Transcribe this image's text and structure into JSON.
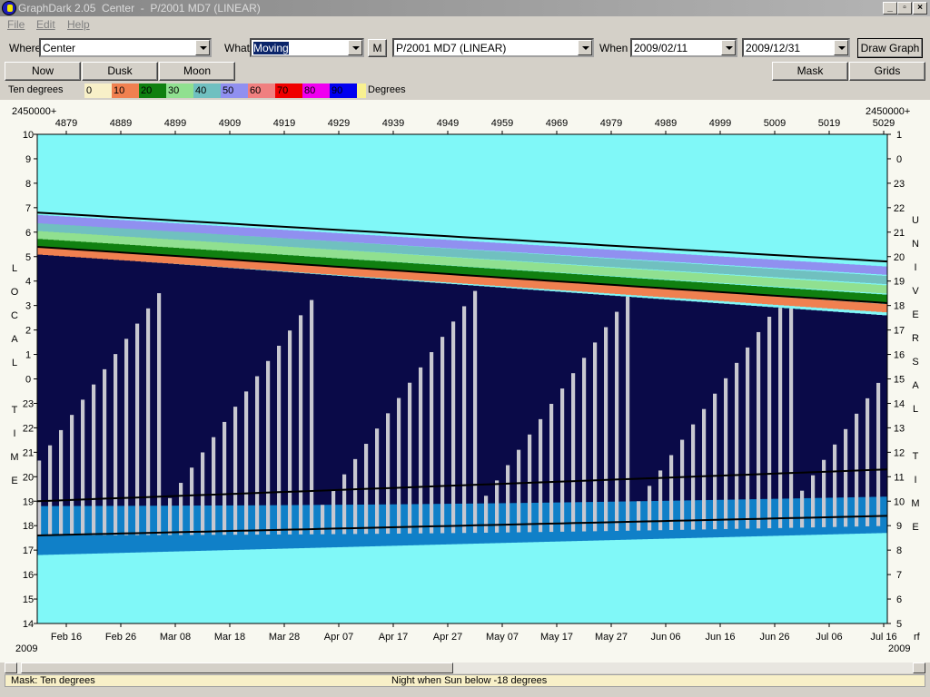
{
  "window": {
    "title": "GraphDark 2.05  Center  -  P/2001 MD7 (LINEAR)"
  },
  "menu": {
    "items": [
      "File",
      "Edit",
      "Help"
    ]
  },
  "toolbar": {
    "where_label": "Where",
    "where_value": "Center",
    "what_label": "What",
    "what_value": "Moving",
    "m_button": "M",
    "object_value": "P/2001 MD7 (LINEAR)",
    "when_label": "When",
    "start_date": "2009/02/11",
    "end_date": "2009/12/31",
    "draw_button": "Draw Graph"
  },
  "buttons": {
    "now": "Now",
    "dusk": "Dusk",
    "moon": "Moon",
    "mask": "Mask",
    "grids": "Grids"
  },
  "legend": {
    "label": "Ten degrees",
    "unit": "Degrees",
    "swatches": [
      {
        "text": "0",
        "color": "#f8f0c8"
      },
      {
        "text": "10",
        "color": "#f08050"
      },
      {
        "text": "20",
        "color": "#108010"
      },
      {
        "text": "30",
        "color": "#90e090"
      },
      {
        "text": "40",
        "color": "#70c0c0"
      },
      {
        "text": "50",
        "color": "#9090f0"
      },
      {
        "text": "60",
        "color": "#f08080"
      },
      {
        "text": "70",
        "color": "#f00000"
      },
      {
        "text": "80",
        "color": "#f000f0"
      },
      {
        "text": "90",
        "color": "#0000f0"
      },
      {
        "text": "",
        "color": "#f8f090"
      }
    ]
  },
  "chart": {
    "jd_prefix_left": "2450000+",
    "jd_prefix_right": "2450000+",
    "jd_ticks": [
      "4879",
      "4889",
      "4899",
      "4909",
      "4919",
      "4929",
      "4939",
      "4949",
      "4959",
      "4969",
      "4979",
      "4989",
      "4999",
      "5009",
      "5019",
      "5029"
    ],
    "left_ticks": [
      "10",
      "9",
      "8",
      "7",
      "6",
      "5",
      "4",
      "3",
      "2",
      "1",
      "0",
      "23",
      "22",
      "21",
      "20",
      "19",
      "18",
      "17",
      "16",
      "15",
      "14"
    ],
    "right_ticks": [
      "1",
      "0",
      "23",
      "22",
      "21",
      "20",
      "19",
      "18",
      "17",
      "16",
      "15",
      "14",
      "13",
      "12",
      "11",
      "10",
      "9",
      "8",
      "7",
      "6",
      "5"
    ],
    "left_title_letters": [
      "L",
      "O",
      "C",
      "A",
      "L",
      "",
      "T",
      "I",
      "M",
      "E"
    ],
    "right_title_letters": [
      "U",
      "N",
      "I",
      "V",
      "E",
      "R",
      "S",
      "A",
      "L",
      "",
      "T",
      "I",
      "M",
      "E"
    ],
    "date_ticks": [
      "Feb 16",
      "Feb 26",
      "Mar 08",
      "Mar 18",
      "Mar 28",
      "Apr 07",
      "Apr 17",
      "Apr 27",
      "May 07",
      "May 17",
      "May 27",
      "Jun 06",
      "Jun 16",
      "Jun 26",
      "Jul 06",
      "Jul 16"
    ],
    "year_left": "2009",
    "year_right": "2009",
    "corner_right": "rf",
    "colors": {
      "day": "#80f8f8",
      "night": "#0a0a48",
      "twilight": "#1080c8",
      "moon": "#c8c8d0"
    }
  },
  "status": {
    "mask": "Mask:  Ten degrees",
    "night": "Night when Sun below -18 degrees"
  }
}
